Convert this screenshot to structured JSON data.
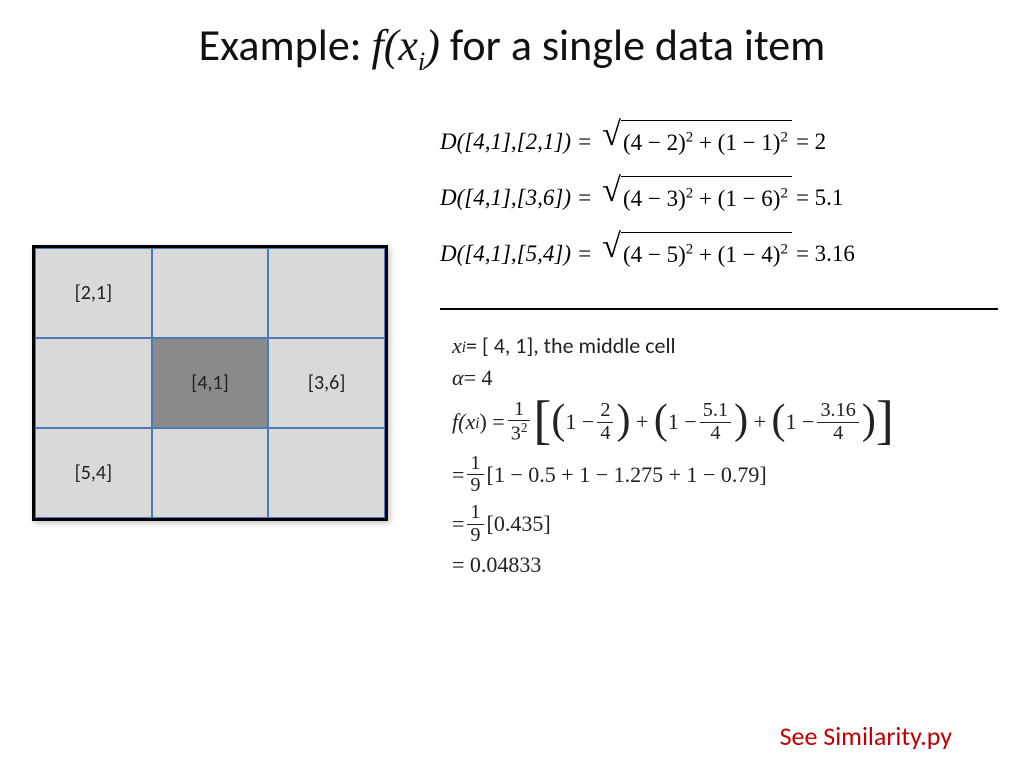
{
  "title": {
    "prefix": "Example: ",
    "fx": "f(x",
    "sub": "i",
    "fx_close": ")",
    "suffix": " for a single data item"
  },
  "grid": {
    "cells": {
      "r0c0": "[2,1]",
      "r1c1": "[4,1]",
      "r1c2": "[3,6]",
      "r2c0": "[5,4]"
    }
  },
  "distance": {
    "row1": {
      "lhs": "D([4,1],[2,1]) =",
      "rad": "(4 − 2)",
      "rad2": " + (1 − 1)",
      "rhs": " = 2"
    },
    "row2": {
      "lhs": "D([4,1],[3,6]) =",
      "rad": "(4 − 3)",
      "rad2": " + (1 − 6)",
      "rhs": " = 5.1"
    },
    "row3": {
      "lhs": "D([4,1],[5,4]) =",
      "rad": "(4 − 5)",
      "rad2": " + (1 − 4)",
      "rhs": " = 3.16"
    }
  },
  "body": {
    "xi_prefix": "x",
    "xi_sub": "i",
    "xi_eq": " =  [ 4, 1], the middle cell",
    "alpha_lhs": "α",
    "alpha_rhs": " = 4",
    "fx_lhs_fx": "f(x",
    "fx_lhs_sub": "i",
    "fx_lhs_close": ") = ",
    "coef_num": "1",
    "coef_den": "3",
    "coef_den_sup": "2",
    "term1_num": "2",
    "term1_den": "4",
    "term2_num": "5.1",
    "term2_den": "4",
    "term3_num": "3.16",
    "term3_den": "4",
    "one": "1",
    "minus": "−",
    "plus": "+",
    "line2_prefix_num": "1",
    "line2_prefix_den": "9",
    "line2_body": "[1 − 0.5 + 1 − 1.275 +  1 − 0.79]",
    "line3_body": " [0.435]",
    "line4": "=  0.04833",
    "eq": "= "
  },
  "footer": "See Similarity.py"
}
